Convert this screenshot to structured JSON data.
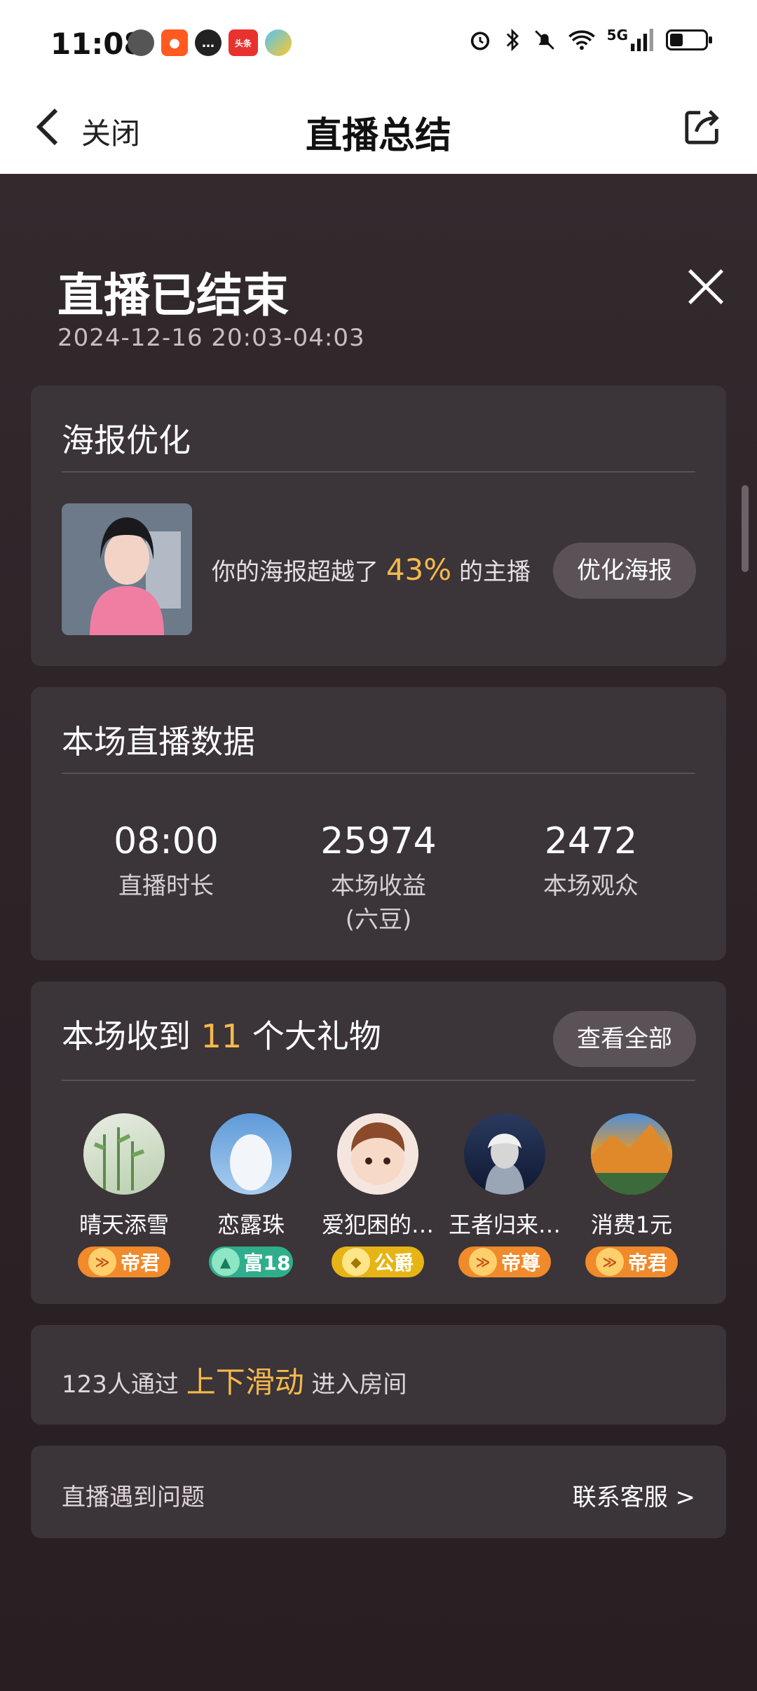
{
  "status_bar": {
    "time": "11:08",
    "signal_text": "5G",
    "icons": [
      "alarm-icon",
      "bluetooth-icon",
      "mute-icon",
      "wifi-icon",
      "signal-icon",
      "battery-icon"
    ]
  },
  "header": {
    "back_label": "关闭",
    "title": "直播总结"
  },
  "summary": {
    "title": "直播已结束",
    "time_range": "2024-12-16 20:03-04:03"
  },
  "poster": {
    "title": "海报优化",
    "text_before": "你的海报超越了",
    "percent": "43%",
    "text_after": "的主播",
    "button": "优化海报"
  },
  "stats": {
    "title": "本场直播数据",
    "items": [
      {
        "value": "08:00",
        "label": "直播时长"
      },
      {
        "value": "25974",
        "label": "本场收益",
        "sublabel": "(六豆)"
      },
      {
        "value": "2472",
        "label": "本场观众"
      }
    ]
  },
  "gifts": {
    "title_before": "本场收到",
    "count": "11",
    "title_after": "个大礼物",
    "button": "查看全部",
    "givers": [
      {
        "name": "晴天添雪",
        "badge": "帝君",
        "badge_color": "#f08a2a"
      },
      {
        "name": "恋露珠",
        "badge": "富18",
        "badge_color": "#2fae8c"
      },
      {
        "name": "爱犯困的…",
        "badge": "公爵",
        "badge_color": "#e7b416"
      },
      {
        "name": "王者归来…",
        "badge": "帝尊",
        "badge_color": "#f08a2a"
      },
      {
        "name": "消费1元",
        "badge": "帝君",
        "badge_color": "#f08a2a"
      }
    ]
  },
  "swipe": {
    "text_before": "123人通过",
    "highlight": "上下滑动",
    "text_after": "进入房间"
  },
  "problem": {
    "text": "直播遇到问题",
    "link": "联系客服 >"
  },
  "colors": {
    "accent": "#f5b94b",
    "card": "#3b3438",
    "background": "#2a2326"
  }
}
